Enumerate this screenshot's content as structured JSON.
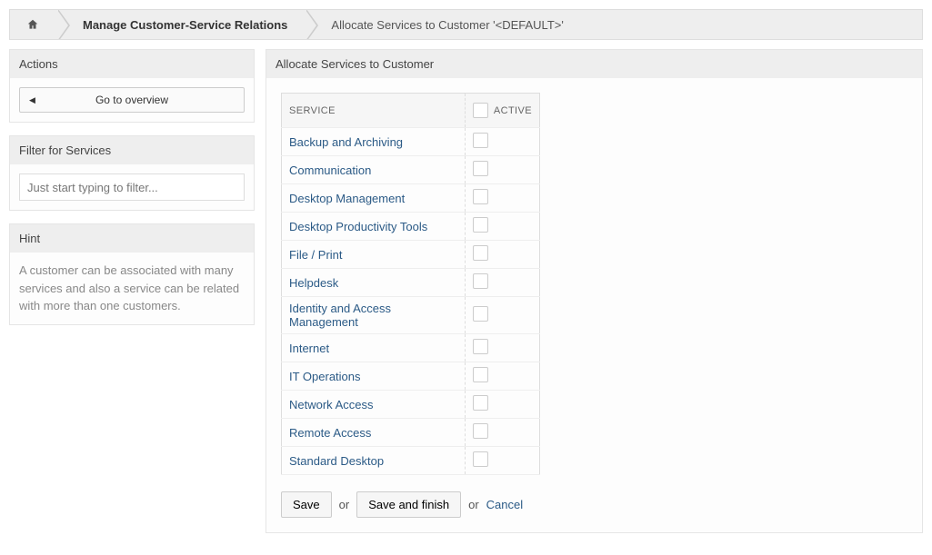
{
  "breadcrumb": {
    "manage": "Manage Customer-Service Relations",
    "allocate": "Allocate Services to Customer '<DEFAULT>'"
  },
  "sidebar": {
    "actions": {
      "title": "Actions",
      "overview": "Go to overview"
    },
    "filter": {
      "title": "Filter for Services",
      "placeholder": "Just start typing to filter..."
    },
    "hint": {
      "title": "Hint",
      "text": "A customer can be associated with many services and also a service can be related with more than one customers."
    }
  },
  "main": {
    "title": "Allocate Services to Customer",
    "columns": {
      "service": "SERVICE",
      "active": "ACTIVE"
    },
    "services": [
      "Backup and Archiving",
      "Communication",
      "Desktop Management",
      "Desktop Productivity Tools",
      "File / Print",
      "Helpdesk",
      "Identity and Access Management",
      "Internet",
      "IT Operations",
      "Network Access",
      "Remote Access",
      "Standard Desktop"
    ],
    "actions": {
      "save": "Save",
      "or1": "or",
      "save_finish": "Save and finish",
      "or2": "or",
      "cancel": "Cancel"
    }
  }
}
